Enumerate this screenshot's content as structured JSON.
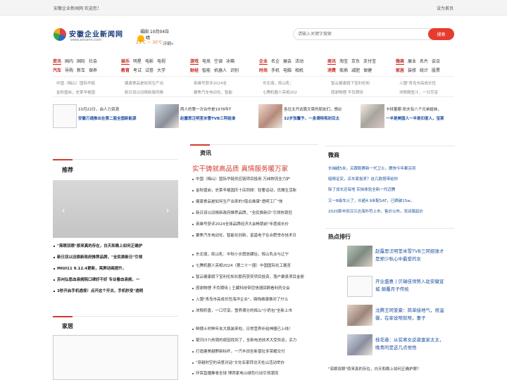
{
  "topbar": {
    "welcome": "安徽企业新闻网  欢迎您！",
    "sethome": "设为首页"
  },
  "logo": {
    "name": "安徽企业新闻网",
    "url": "www.ahcenn.com"
  },
  "weather": {
    "city": "福田 10月04日",
    "condition": "晴",
    "temp": "23℃ ~ 30℃",
    "more": "详细»"
  },
  "search": {
    "placeholder": "请输入关键字搜索",
    "button": "搜索"
  },
  "nav": [
    {
      "r1": [
        "资讯",
        "国内",
        "国际",
        "社会"
      ],
      "r2": [
        "汽车",
        "导购",
        "新车",
        "保养"
      ]
    },
    {
      "r1": [
        "娱乐",
        "明星",
        "电影",
        "电视"
      ],
      "r2": [
        "教育",
        "考试",
        "试卷",
        "大学"
      ]
    },
    {
      "r1": [
        "游戏",
        "电竞",
        "空调",
        "冰箱"
      ],
      "r2": [
        "财经",
        "智能",
        "机器人",
        "识别"
      ]
    },
    {
      "r1": [
        "企业",
        "名企",
        "展会",
        "活动"
      ],
      "r2": [
        "时尚",
        "手机",
        "电脑",
        "相机"
      ]
    },
    {
      "r1": [
        "商讯",
        "淘宝",
        "京东",
        "支付宝"
      ],
      "r2": [
        "消费",
        "疾病",
        "减肥",
        "保健"
      ]
    },
    {
      "r1": [
        "微商",
        "展业",
        "名片",
        "会议"
      ],
      "r2": [
        "家居",
        "装修",
        "统计",
        "股票"
      ]
    }
  ],
  "tagline": [
    [
      "中国（梅山）国际华链",
      "健康食品是如何生产出",
      "英雄号获评2024全",
      "东北填，辉山乳：",
      "智云健康旗下宝利伦知",
      "入围\"青岛市高成长性"
    ],
    [
      "金秋盛启，史莱辛格国",
      "新日双以旧换新政府推",
      "聚焦汽车电动化、智能",
      "七腾机器人亮相202",
      "感谢物理 不负期待",
      "浓郁鲍鱼汁，一日尽享"
    ]
  ],
  "features": [
    {
      "l1": "10月22日，由人力资源",
      "l2": "安徽万通推出在第二届全国新能源"
    },
    {
      "l1": "两人的第一次合作是1978年T",
      "l2": "赵露思汪明荃米雪TVB三阿姐谁"
    },
    {
      "l1": "各位太开这篇文章的朋友们，想必",
      "l2": "32岁张馨予，一身满特氛封后太"
    },
    {
      "l1": "卡特董娜·凯夫有八个兄弟姐妹，",
      "l2": "一半是美国人一半是印度人，宝莱"
    }
  ],
  "panels": {
    "recommend": "推荐",
    "news": "资讯",
    "biz": "微商",
    "hot": "热点排行",
    "home": "家居"
  },
  "headline": "实干铸就高品质 真情服务暖万家",
  "recommend_list": [
    "\"亮眼双眼\"原来真的存在，白天和晚上如何正确护",
    "新日双以旧换新政府推荐品牌，\"全民换新日\"引领",
    "MIUI11 9.12.4更新，亮屏动画提升，",
    "苏州弘悠血液病院口碑好不好 专业看血液病，一",
    "3秒开启手机透视！点开这个开关，手机秒变\"透明"
  ],
  "news_list_a": [
    "中国（梅山）国际华链供应链项目投用 万纬物流全力护",
    "金秋盛启，史莱辛格国庆十店同频：轻奢运动，优雅生活新",
    "健康食品是如何生产出来的?南瓜维康\"透明工厂\"体",
    "新日双以旧换新政府推荐品牌，\"全民换新日\"引领热销狂",
    "英雄号获评2024全球品牌经济大会畅销前\"年度成长价",
    "聚焦汽车电动化、智能化创新，富昌电子在合肥举办技术日"
  ],
  "news_list_b": [
    "东北填，辉山乳：中秋小长假放肆玩，辉山乳业与辽宁",
    "七腾机器人亮相2024（第二十一届）中国国际化工展览",
    "智云健康旗下宝利伦知长郡药获奖项目投资，落户聚县项目金册",
    "感谢物理 不负期待 | 王藏科技带您快速回顾看利药交会",
    "入围\"青岛市高成长性海洋企业\"，鼎栈维康做对了什么",
    "浓郁奶香，一口尽享。雪养满分的辉山\"小奶包\"全新上市"
  ],
  "news_list_c": [
    "鲜搏士时鲜年夹大瓶装来啦，日常营养补给神器已上线！",
    "银河(57)热销的原因找到了，全新电池技术大受欢迎，买力",
    "打造健美越野新标杆，一汽丰田全新普拉多荣耀交付",
    "\"穿越时空的诗意对话\"文化名家拜访天柱山活动举办",
    "环保直播推卷全球 博西家电以绿色行动引领潮流"
  ],
  "biz_list": [
    "长袖超5米，买跟跑赛新一代卫士，鹿快今年都买到",
    "暗情证实，买车家投奖？这几款搭带给你",
    "除了加长还有啥 实拍体验全新一代迈腾",
    "又一B级车火了，长超4.9米配SAT，已跌破15w，",
    "2020款丰田汉兰达海外符上市，售价公布，流动版起价"
  ],
  "hot_list": [
    {
      "txt": "赵露思汪明荃米雪TVB三阿姐谁才是郑少秋心中最爱的女"
    },
    {
      "txt": "开业盛惠 | 贝瑞佳领势入驻安徽宣城 颠覆月子传统"
    },
    {
      "txt": "沈腾王珂爱豪：简单接地气，很温馨，在家说啥就啥，妻子"
    },
    {
      "txt": "桂花巷：从贫寒女逆袭富家太太，晚青的是这几点觉悟"
    }
  ],
  "bottom_line": "\"亮眼双眼\"原来真的存在，白天和晚上如何正确护眼？"
}
